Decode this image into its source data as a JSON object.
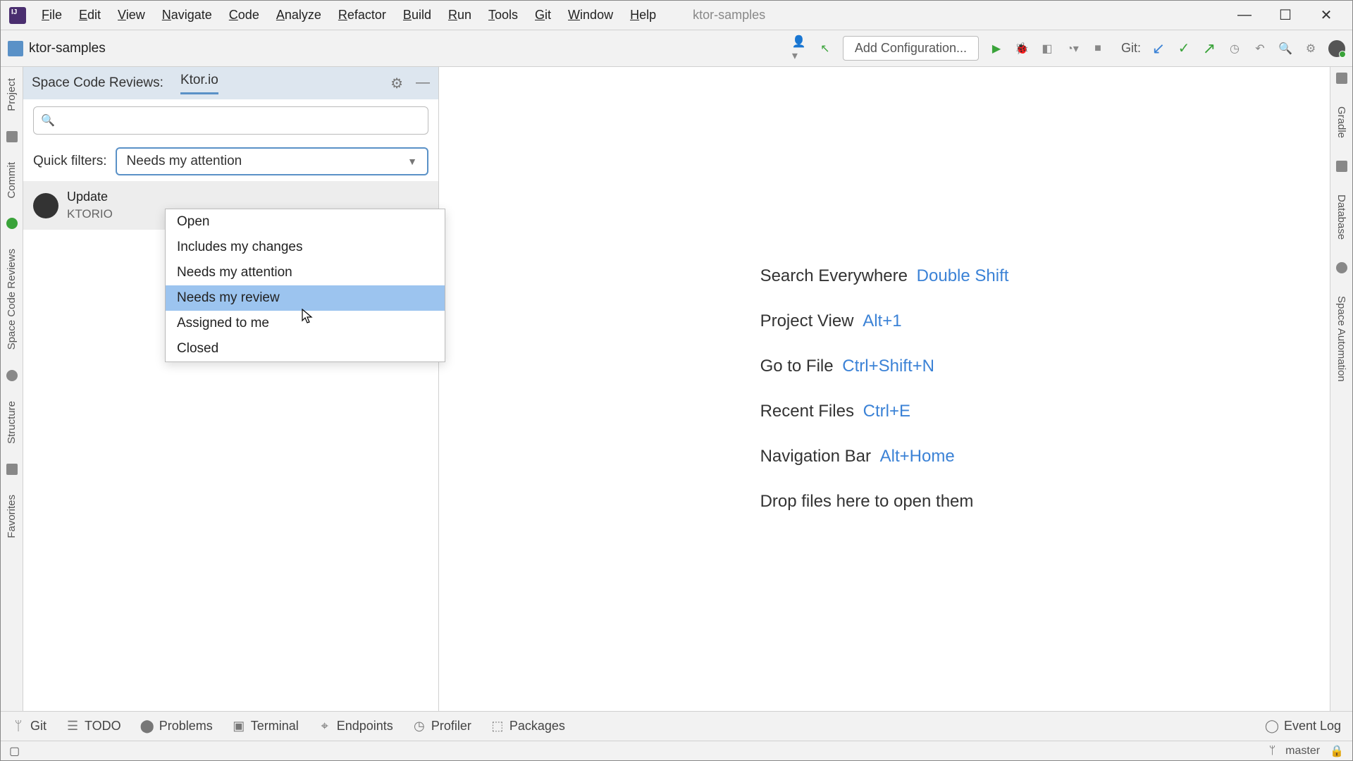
{
  "menu": {
    "items": [
      "File",
      "Edit",
      "View",
      "Navigate",
      "Code",
      "Analyze",
      "Refactor",
      "Build",
      "Run",
      "Tools",
      "Git",
      "Window",
      "Help"
    ],
    "title": "ktor-samples"
  },
  "toolbar": {
    "project": "ktor-samples",
    "config": "Add Configuration...",
    "git_label": "Git:"
  },
  "left_rail": {
    "items": [
      "Project",
      "Commit",
      "Space Code Reviews",
      "Structure",
      "Favorites"
    ]
  },
  "right_rail": {
    "items": [
      "Gradle",
      "Database",
      "Space Automation"
    ]
  },
  "panel": {
    "title": "Space Code Reviews:",
    "tab": "Ktor.io",
    "search_placeholder": "",
    "filter_label": "Quick filters:",
    "filter_selected": "Needs my attention",
    "filter_options": [
      "Open",
      "Includes my changes",
      "Needs my attention",
      "Needs my review",
      "Assigned to me",
      "Closed"
    ],
    "highlighted_index": 3,
    "review": {
      "title": "Update",
      "sub": "KTORIO"
    }
  },
  "editor": {
    "shortcuts": [
      {
        "label": "Search Everywhere",
        "key": "Double Shift"
      },
      {
        "label": "Project View",
        "key": "Alt+1"
      },
      {
        "label": "Go to File",
        "key": "Ctrl+Shift+N"
      },
      {
        "label": "Recent Files",
        "key": "Ctrl+E"
      },
      {
        "label": "Navigation Bar",
        "key": "Alt+Home"
      }
    ],
    "drop_hint": "Drop files here to open them"
  },
  "bottombar": {
    "items": [
      "Git",
      "TODO",
      "Problems",
      "Terminal",
      "Endpoints",
      "Profiler",
      "Packages"
    ],
    "event_log": "Event Log"
  },
  "statusbar": {
    "branch": "master"
  }
}
